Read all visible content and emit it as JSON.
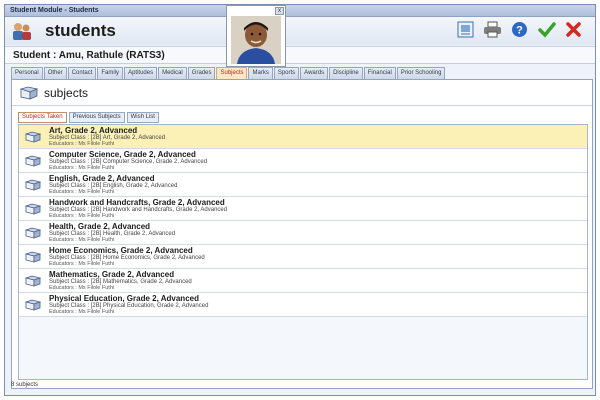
{
  "window": {
    "title": "Student Module - Students"
  },
  "header": {
    "module_title": "students",
    "module_icon": "students-icon"
  },
  "photo": {
    "close_label": "x",
    "subject": "student-photo"
  },
  "toolbar": {
    "icons": [
      {
        "name": "report-icon",
        "color": "#3b6fb0"
      },
      {
        "name": "print-icon",
        "color": "#555555"
      },
      {
        "name": "help-icon",
        "color": "#2a67c6"
      },
      {
        "name": "check-icon",
        "color": "#3aa12b"
      },
      {
        "name": "close-icon",
        "color": "#d22a1f"
      }
    ]
  },
  "student": {
    "label": "Student : Amu, Rathule (RATS3)"
  },
  "tabs": [
    {
      "label": "Personal"
    },
    {
      "label": "Other"
    },
    {
      "label": "Contact"
    },
    {
      "label": "Family"
    },
    {
      "label": "Aptitudes"
    },
    {
      "label": "Medical"
    },
    {
      "label": "Grades"
    },
    {
      "label": "Subjects"
    },
    {
      "label": "Marks"
    },
    {
      "label": "Sports"
    },
    {
      "label": "Awards"
    },
    {
      "label": "Discipline"
    },
    {
      "label": "Financial"
    },
    {
      "label": "Prior Schooling"
    }
  ],
  "active_tab": "Subjects",
  "section": {
    "title": "subjects"
  },
  "subtabs": [
    {
      "label": "Subjects Taken"
    },
    {
      "label": "Previous Subjects"
    },
    {
      "label": "Wish List"
    }
  ],
  "subjects": [
    {
      "title": "Art, Grade 2, Advanced",
      "class": "Subject Class : [2B] Art, Grade 2, Advanced",
      "educators": "Educators : Ms Filole Futhi"
    },
    {
      "title": "Computer Science, Grade 2, Advanced",
      "class": "Subject Class : [2B] Computer Science, Grade 2, Advanced",
      "educators": "Educators : Ms Filole Futhi"
    },
    {
      "title": "English, Grade 2, Advanced",
      "class": "Subject Class : [2B] English, Grade 2, Advanced",
      "educators": "Educators : Ms Filole Futhi"
    },
    {
      "title": "Handwork and Handcrafts, Grade 2, Advanced",
      "class": "Subject Class : [2B] Handwork and Handcrafts, Grade 2, Advanced",
      "educators": "Educators : Ms Filole Futhi"
    },
    {
      "title": "Health, Grade 2, Advanced",
      "class": "Subject Class : [2B] Health, Grade 2, Advanced",
      "educators": "Educators : Ms Filole Futhi"
    },
    {
      "title": "Home Economics, Grade 2, Advanced",
      "class": "Subject Class : [2B] Home Economics, Grade 2, Advanced",
      "educators": "Educators : Ms Filole Futhi"
    },
    {
      "title": "Mathematics, Grade 2, Advanced",
      "class": "Subject Class : [2B] Mathematics, Grade 2, Advanced",
      "educators": "Educators : Ms Filole Futhi"
    },
    {
      "title": "Physical Education, Grade 2, Advanced",
      "class": "Subject Class : [2B] Physical Education, Grade 2, Advanced",
      "educators": "Educators : Ms Filole Futhi"
    }
  ],
  "selected_subject": "Art, Grade 2, Advanced",
  "status": {
    "text": "8 subjects"
  }
}
